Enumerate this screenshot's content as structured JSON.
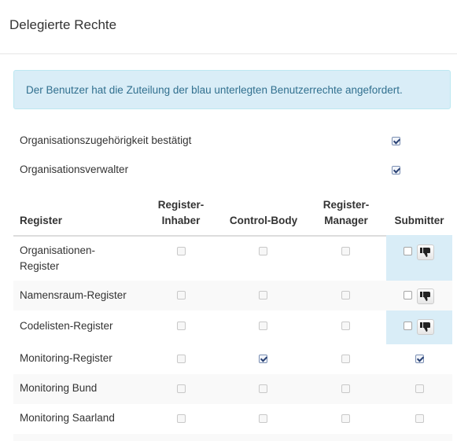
{
  "header": {
    "title": "Delegierte Rechte"
  },
  "info": {
    "message": "Der Benutzer hat die Zuteilung der blau unterlegten Benutzerrechte angefordert."
  },
  "permissions": [
    {
      "label": "Organisationszugehörigkeit bestätigt",
      "checked": true
    },
    {
      "label": "Organisationsverwalter",
      "checked": true
    }
  ],
  "table": {
    "headers": {
      "register": "Register",
      "inhaber_line1": "Register-",
      "inhaber_line2": "Inhaber",
      "control_body": "Control-Body",
      "manager_line1": "Register-",
      "manager_line2": "Manager",
      "submitter": "Submitter"
    },
    "rows": [
      {
        "name_line1": "Organisationen-",
        "name_line2": "Register",
        "inhaber": false,
        "control_body": false,
        "manager": false,
        "submitter": false,
        "requested": true
      },
      {
        "name": "Namensraum-Register",
        "inhaber": false,
        "control_body": false,
        "manager": false,
        "submitter": false,
        "requested": true
      },
      {
        "name": "Codelisten-Register",
        "inhaber": false,
        "control_body": false,
        "manager": false,
        "submitter": false,
        "requested": true
      },
      {
        "name": "Monitoring-Register",
        "inhaber": false,
        "control_body": true,
        "manager": false,
        "submitter": true,
        "requested": false
      },
      {
        "name": "Monitoring Bund",
        "inhaber": false,
        "control_body": false,
        "manager": false,
        "submitter": false,
        "requested": false
      },
      {
        "name": "Monitoring Saarland",
        "inhaber": false,
        "control_body": false,
        "manager": false,
        "submitter": false,
        "requested": false
      }
    ]
  },
  "colors": {
    "info_bg": "#d9edf7",
    "info_text": "#31708f",
    "requested_bg": "#d9edf7"
  },
  "icons": {
    "deny": "thumbs-down-icon"
  }
}
